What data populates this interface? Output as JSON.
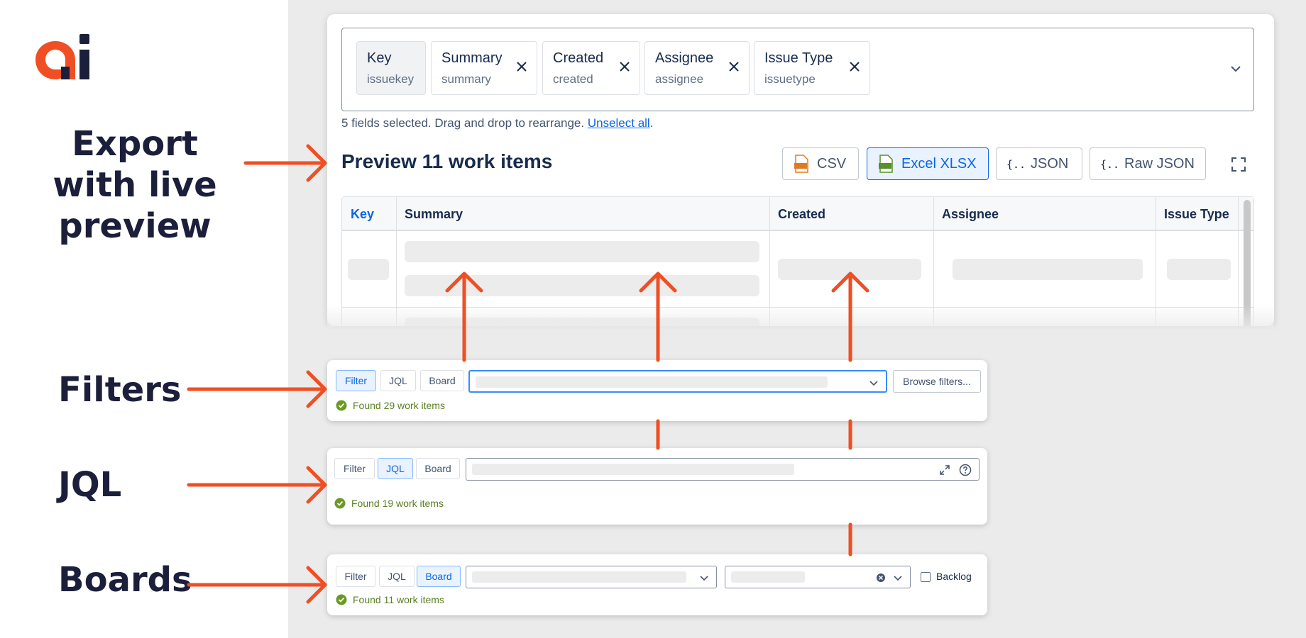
{
  "features": {
    "export": "Export with live preview",
    "filters": "Filters",
    "jql": "JQL",
    "boards": "Boards"
  },
  "brand": {
    "logo_color": "#f04e23",
    "dark": "#1b1f3b",
    "arrow_color": "#f04e23"
  },
  "export": {
    "fields": [
      {
        "label": "Key",
        "sub": "issuekey",
        "removable": false
      },
      {
        "label": "Summary",
        "sub": "summary",
        "removable": true
      },
      {
        "label": "Created",
        "sub": "created",
        "removable": true
      },
      {
        "label": "Assignee",
        "sub": "assignee",
        "removable": true
      },
      {
        "label": "Issue Type",
        "sub": "issuetype",
        "removable": true
      }
    ],
    "help_text": "5 fields selected. Drag and drop to rearrange.",
    "unselect_all": "Unselect all",
    "help_period": ".",
    "preview_title": "Preview 11 work items",
    "formats": [
      {
        "label": "CSV",
        "icon": "csv-file-icon",
        "selected": false
      },
      {
        "label": "Excel XLSX",
        "icon": "xlsx-file-icon",
        "selected": true
      },
      {
        "label": "JSON",
        "icon": "json-braces-icon",
        "selected": false
      },
      {
        "label": "Raw JSON",
        "icon": "json-braces-icon",
        "selected": false
      }
    ],
    "table": {
      "columns": [
        "Key",
        "Summary",
        "Created",
        "Assignee",
        "Issue Type"
      ]
    }
  },
  "filters_panel": {
    "tabs": [
      "Filter",
      "JQL",
      "Board"
    ],
    "selected_tab": "Filter",
    "browse_button": "Browse filters...",
    "status": "Found 29 work items"
  },
  "jql_panel": {
    "tabs": [
      "Filter",
      "JQL",
      "Board"
    ],
    "selected_tab": "JQL",
    "status": "Found 19 work items"
  },
  "boards_panel": {
    "tabs": [
      "Filter",
      "JQL",
      "Board"
    ],
    "selected_tab": "Board",
    "backlog_label": "Backlog",
    "backlog_checked": false,
    "status": "Found 11 work items"
  }
}
